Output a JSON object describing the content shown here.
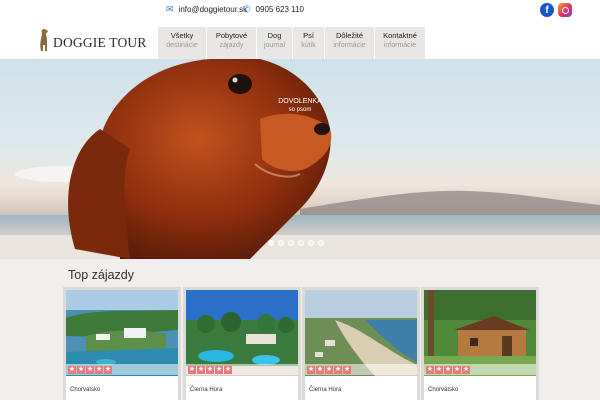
{
  "topbar": {
    "email": "info@doggietour.sk",
    "phone": "0905 623 110",
    "social": [
      "facebook-icon",
      "instagram-icon"
    ]
  },
  "logo": {
    "text": "DOGGIE TOUR"
  },
  "nav": [
    {
      "title": "Všetky",
      "sub": "destinácie"
    },
    {
      "title": "Pobytové",
      "sub": "zájazdy"
    },
    {
      "title": "Dog",
      "sub": "journal"
    },
    {
      "title": "Psí",
      "sub": "kútik"
    },
    {
      "title": "Dôležité",
      "sub": "informácie"
    },
    {
      "title": "Kontaktné",
      "sub": "informácie"
    }
  ],
  "hero": {
    "caption_line1": "DOVOLENKA",
    "caption_line2": "so psom",
    "slides": 6,
    "active_slide": 1
  },
  "top_trips": {
    "title": "Top zájazdy",
    "cards": [
      {
        "country": "Chorvátsko",
        "rating": 5
      },
      {
        "country": "Čierna Hora",
        "rating": 5
      },
      {
        "country": "Čierna Hora",
        "rating": 5
      },
      {
        "country": "Chorvátsko",
        "rating": 5
      }
    ]
  },
  "colors": {
    "accent": "#2f7bd6",
    "star": "#e8797d",
    "nav_bg": "#e9e7e5",
    "facebook": "#1b54c6"
  }
}
